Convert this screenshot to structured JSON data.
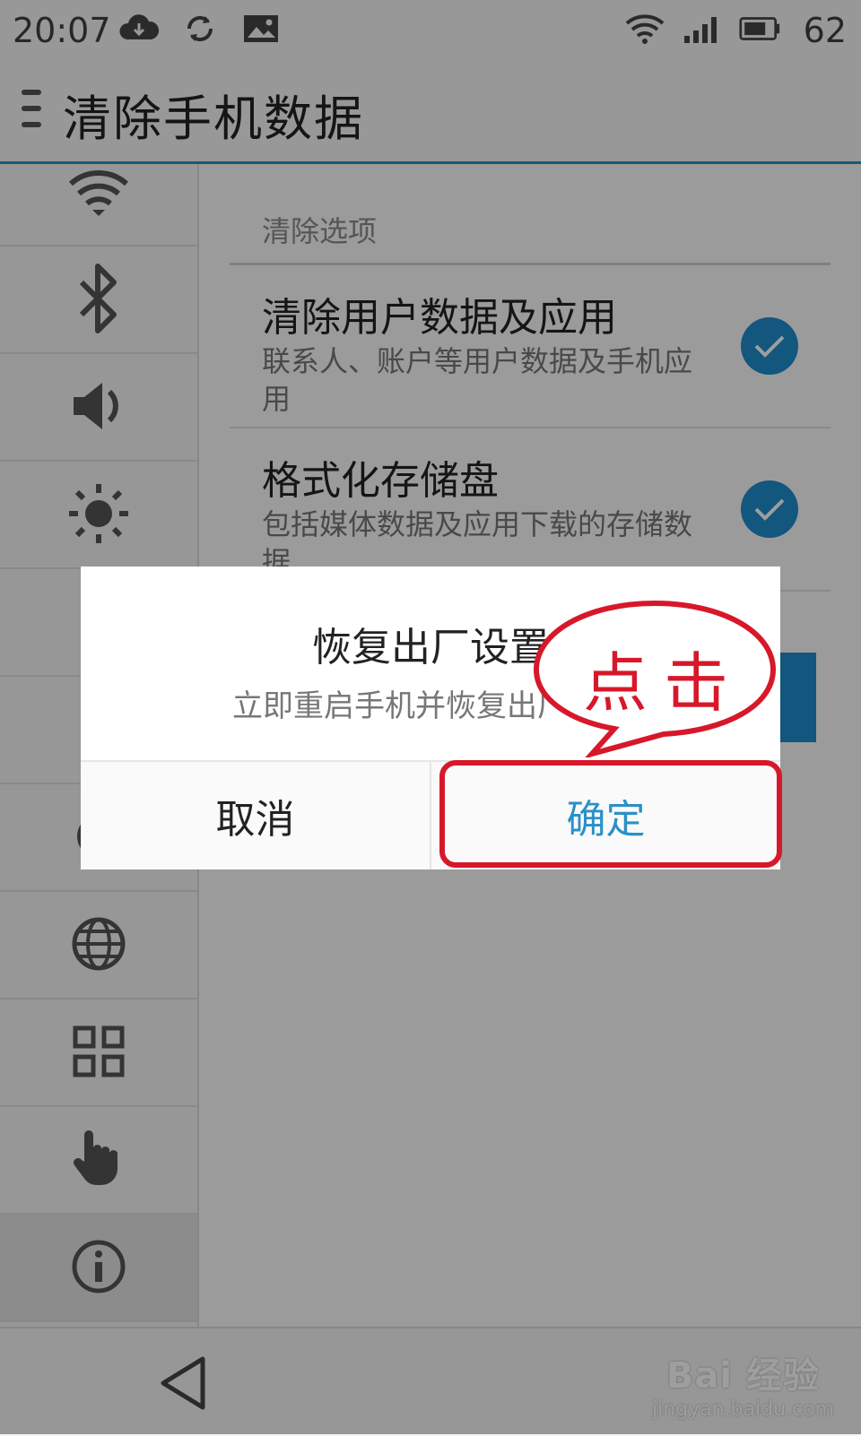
{
  "status_bar": {
    "time": "20:07",
    "battery": "62",
    "left_icons": [
      "cloud-download-icon",
      "sync-icon",
      "image-icon"
    ],
    "right_icons": [
      "wifi-icon",
      "signal-icon",
      "battery-icon"
    ]
  },
  "header": {
    "title": "清除手机数据",
    "menu_icon": "menu-icon"
  },
  "sidebar": {
    "items": [
      {
        "icon": "wifi-icon"
      },
      {
        "icon": "bluetooth-icon"
      },
      {
        "icon": "volume-icon"
      },
      {
        "icon": "brightness-icon"
      },
      {
        "icon": "battery-icon"
      },
      {
        "icon": "storage-icon"
      },
      {
        "icon": "circle-icon"
      },
      {
        "icon": "globe-icon"
      },
      {
        "icon": "apps-grid-icon"
      },
      {
        "icon": "hand-gesture-icon"
      },
      {
        "icon": "info-icon"
      }
    ]
  },
  "content": {
    "section_header": "清除选项",
    "options": [
      {
        "title": "清除用户数据及应用",
        "desc": "联系人、账户等用户数据及手机应用",
        "checked": true
      },
      {
        "title": "格式化存储盘",
        "desc": "包括媒体数据及应用下载的存储数据",
        "checked": true
      }
    ]
  },
  "dialog": {
    "title": "恢复出厂设置",
    "message": "立即重启手机并恢复出厂设置",
    "cancel_label": "取消",
    "confirm_label": "确定"
  },
  "annotation": {
    "callout_text": "点击",
    "color": "#d7182a"
  },
  "watermark": {
    "logo": "Bai 经验",
    "url": "jingyan.baidu.com"
  },
  "colors": {
    "accent": "#2b90c8",
    "check": "#1f8ccc"
  }
}
